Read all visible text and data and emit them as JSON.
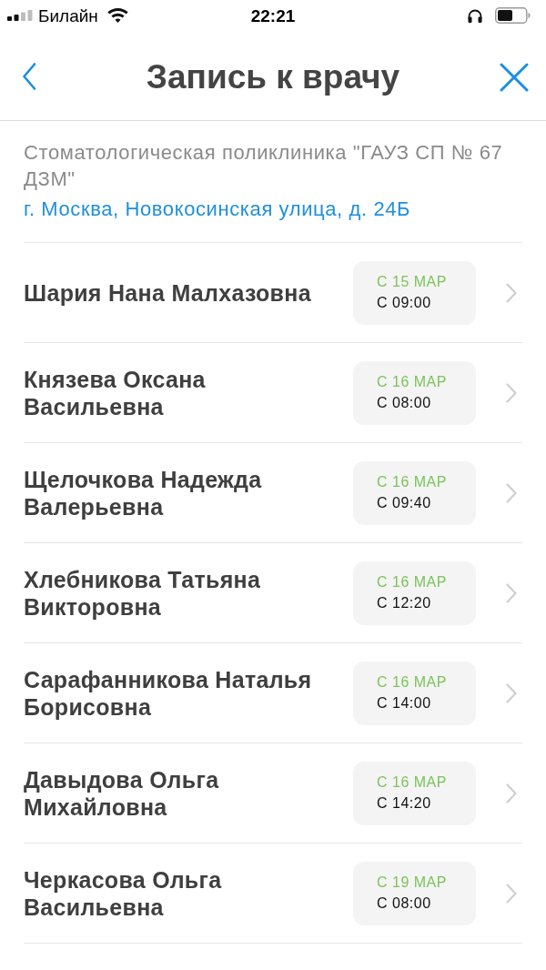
{
  "status_bar": {
    "carrier": "Билайн",
    "time": "22:21"
  },
  "nav": {
    "title": "Запись к врачу"
  },
  "clinic": {
    "name": "Стоматологическая поликлиника \"ГАУЗ СП № 67 ДЗМ\"",
    "address": "г. Москва, Новокосинская улица, д. 24Б"
  },
  "doctors": [
    {
      "name": "Шария Нана Малхазовна",
      "date": "С 15 МАР",
      "time": "С 09:00"
    },
    {
      "name": "Князева Оксана Васильевна",
      "date": "С 16 МАР",
      "time": "С 08:00"
    },
    {
      "name": "Щелочкова Надежда Валерьевна",
      "date": "С 16 МАР",
      "time": "С 09:40"
    },
    {
      "name": "Хлебникова Татьяна Викторовна",
      "date": "С 16 МАР",
      "time": "С 12:20"
    },
    {
      "name": "Сарафанникова Наталья Борисовна",
      "date": "С 16 МАР",
      "time": "С 14:00"
    },
    {
      "name": "Давыдова Ольга Михайловна",
      "date": "С 16 МАР",
      "time": "С 14:20"
    },
    {
      "name": "Черкасова Ольга Васильевна",
      "date": "С 19 МАР",
      "time": "С 08:00"
    }
  ]
}
